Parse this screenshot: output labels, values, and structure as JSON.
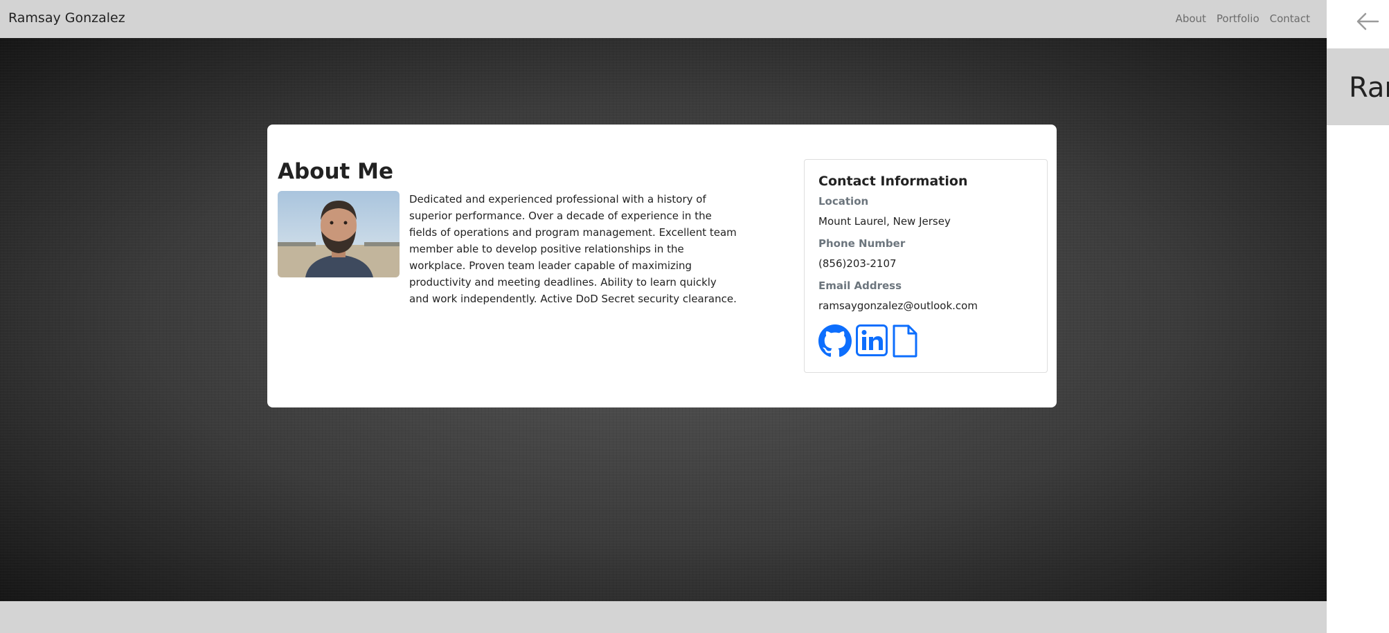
{
  "navbar": {
    "brand": "Ramsay Gonzalez",
    "links": [
      "About",
      "Portfolio",
      "Contact"
    ]
  },
  "about": {
    "title": "About Me",
    "bio": "Dedicated and experienced professional with a history of superior performance. Over a decade of experience in the fields of operations and program management. Excellent team member able to develop positive relationships in the workplace. Proven team leader capable of maximizing productivity and meeting deadlines. Ability to learn quickly and work independently. Active DoD Secret security clearance."
  },
  "contact": {
    "title": "Contact Information",
    "location_label": "Location",
    "location_value": "Mount Laurel, New Jersey",
    "phone_label": "Phone Number",
    "phone_value": "(856)203-2107",
    "email_label": "Email Address",
    "email_value": "ramsaygonzalez@outlook.com",
    "icons": [
      "github-icon",
      "linkedin-icon",
      "document-icon"
    ]
  },
  "side_panel": {
    "header_text": "Ran",
    "icon": "arrow-left-icon"
  },
  "colors": {
    "accent": "#0d6efd",
    "navbar_bg": "#d3d3d3",
    "label": "#6c757d"
  }
}
